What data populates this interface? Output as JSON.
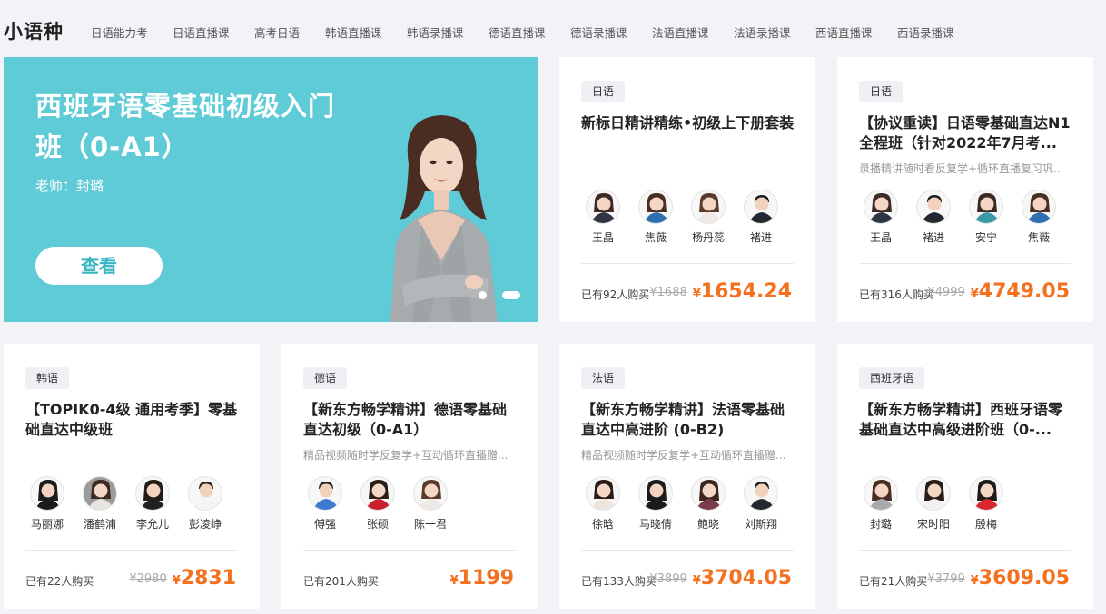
{
  "brand": "小语种",
  "nav": [
    "日语能力考",
    "日语直播课",
    "高考日语",
    "韩语直播课",
    "韩语录播课",
    "德语直播课",
    "德语录播课",
    "法语直播课",
    "法语录播课",
    "西语直播课",
    "西语录播课"
  ],
  "banner": {
    "title": "西班牙语零基础初级入门班（0-A1）",
    "teacher": "老师：封璐",
    "button": "查看",
    "background": "#5ecbd6",
    "slides": 2,
    "active_slide": 1
  },
  "colors": {
    "price": "#f4711f",
    "tag_bg": "#eef0f4",
    "page_bg": "#f2f3f7"
  },
  "cards": [
    {
      "tag": "日语",
      "title": "新标日精讲精练•初级上下册套装",
      "subtitle": "",
      "teachers": [
        "王晶",
        "焦薇",
        "杨丹蕊",
        "褚进"
      ],
      "buyers": "已有92人购买",
      "old_price": "¥1688",
      "price": "1654.24",
      "currency": "¥"
    },
    {
      "tag": "日语",
      "title": "【协议重读】日语零基础直达N1全程班（针对2022年7月考...",
      "subtitle": "录播精讲随时看反复学+循环直播复习巩...",
      "teachers": [
        "王晶",
        "褚进",
        "安宁",
        "焦薇"
      ],
      "buyers": "已有316人购买",
      "old_price": "¥4999",
      "price": "4749.05",
      "currency": "¥"
    },
    {
      "tag": "韩语",
      "title": "【TOPIK0-4级 通用考季】零基础直达中级班",
      "subtitle": "",
      "teachers": [
        "马丽娜",
        "潘鹤浦",
        "李允儿",
        "彭凌峥"
      ],
      "buyers": "已有22人购买",
      "old_price": "¥2980",
      "price": "2831",
      "currency": "¥"
    },
    {
      "tag": "德语",
      "title": "【新东方畅学精讲】德语零基础直达初级（0-A1）",
      "subtitle": "精品视频随时学反复学+互动循环直播赠...",
      "teachers": [
        "傅强",
        "张硕",
        "陈一君"
      ],
      "buyers": "已有201人购买",
      "old_price": "",
      "price": "1199",
      "currency": "¥"
    },
    {
      "tag": "法语",
      "title": "【新东方畅学精讲】法语零基础直达中高进阶 (0-B2)",
      "subtitle": "精品视频随时学反复学+互动循环直播赠...",
      "teachers": [
        "徐晗",
        "马晓倩",
        "鲍晓",
        "刘斯翔"
      ],
      "buyers": "已有133人购买",
      "old_price": "¥3899",
      "price": "3704.05",
      "currency": "¥"
    },
    {
      "tag": "西班牙语",
      "title": "【新东方畅学精讲】西班牙语零基础直达中高级进阶班（0-...",
      "subtitle": "",
      "teachers": [
        "封璐",
        "宋时阳",
        "殷梅"
      ],
      "buyers": "已有21人购买",
      "old_price": "¥3799",
      "price": "3609.05",
      "currency": "¥"
    }
  ]
}
